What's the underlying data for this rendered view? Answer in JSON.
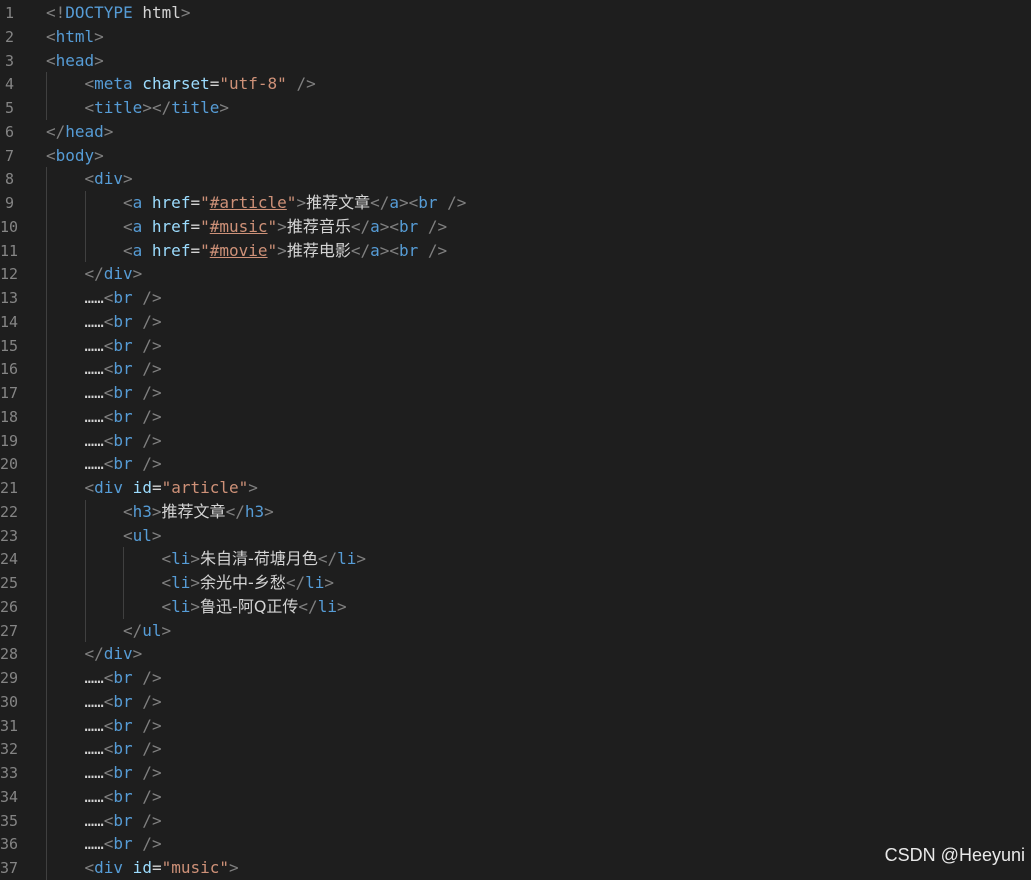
{
  "editor": {
    "lines": [
      {
        "n": "1",
        "indent": 0,
        "tokens": [
          [
            "br",
            "<!"
          ],
          [
            "doc",
            "DOCTYPE"
          ],
          [
            "txt",
            " html"
          ],
          [
            "br",
            ">"
          ]
        ]
      },
      {
        "n": "2",
        "indent": 0,
        "tokens": [
          [
            "br",
            "<"
          ],
          [
            "tag",
            "html"
          ],
          [
            "br",
            ">"
          ]
        ]
      },
      {
        "n": "3",
        "indent": 0,
        "tokens": [
          [
            "br",
            "<"
          ],
          [
            "tag",
            "head"
          ],
          [
            "br",
            ">"
          ]
        ]
      },
      {
        "n": "4",
        "indent": 1,
        "tokens": [
          [
            "br",
            "<"
          ],
          [
            "tag",
            "meta"
          ],
          [
            "attr",
            " charset"
          ],
          [
            "txt",
            "="
          ],
          [
            "str",
            "\"utf-8\""
          ],
          [
            "br",
            " />"
          ]
        ]
      },
      {
        "n": "5",
        "indent": 1,
        "tokens": [
          [
            "br",
            "<"
          ],
          [
            "tag",
            "title"
          ],
          [
            "br",
            "></"
          ],
          [
            "tag",
            "title"
          ],
          [
            "br",
            ">"
          ]
        ]
      },
      {
        "n": "6",
        "indent": 0,
        "tokens": [
          [
            "br",
            "</"
          ],
          [
            "tag",
            "head"
          ],
          [
            "br",
            ">"
          ]
        ]
      },
      {
        "n": "7",
        "indent": 0,
        "tokens": [
          [
            "br",
            "<"
          ],
          [
            "tag",
            "body"
          ],
          [
            "br",
            ">"
          ]
        ]
      },
      {
        "n": "8",
        "indent": 1,
        "tokens": [
          [
            "br",
            "<"
          ],
          [
            "tag",
            "div"
          ],
          [
            "br",
            ">"
          ]
        ]
      },
      {
        "n": "9",
        "indent": 2,
        "tokens": [
          [
            "br",
            "<"
          ],
          [
            "tag",
            "a"
          ],
          [
            "attr",
            " href"
          ],
          [
            "txt",
            "="
          ],
          [
            "str",
            "\""
          ],
          [
            "hl",
            "#article"
          ],
          [
            "str",
            "\""
          ],
          [
            "br",
            ">"
          ],
          [
            "cjk",
            "推荐文章"
          ],
          [
            "br",
            "</"
          ],
          [
            "tag",
            "a"
          ],
          [
            "br",
            "><"
          ],
          [
            "tag",
            "br"
          ],
          [
            "br",
            " />"
          ]
        ]
      },
      {
        "n": "10",
        "indent": 2,
        "tokens": [
          [
            "br",
            "<"
          ],
          [
            "tag",
            "a"
          ],
          [
            "attr",
            " href"
          ],
          [
            "txt",
            "="
          ],
          [
            "str",
            "\""
          ],
          [
            "hl",
            "#music"
          ],
          [
            "str",
            "\""
          ],
          [
            "br",
            ">"
          ],
          [
            "cjk",
            "推荐音乐"
          ],
          [
            "br",
            "</"
          ],
          [
            "tag",
            "a"
          ],
          [
            "br",
            "><"
          ],
          [
            "tag",
            "br"
          ],
          [
            "br",
            " />"
          ]
        ]
      },
      {
        "n": "11",
        "indent": 2,
        "tokens": [
          [
            "br",
            "<"
          ],
          [
            "tag",
            "a"
          ],
          [
            "attr",
            " href"
          ],
          [
            "txt",
            "="
          ],
          [
            "str",
            "\""
          ],
          [
            "hl",
            "#movie"
          ],
          [
            "str",
            "\""
          ],
          [
            "br",
            ">"
          ],
          [
            "cjk",
            "推荐电影"
          ],
          [
            "br",
            "</"
          ],
          [
            "tag",
            "a"
          ],
          [
            "br",
            "><"
          ],
          [
            "tag",
            "br"
          ],
          [
            "br",
            " />"
          ]
        ]
      },
      {
        "n": "12",
        "indent": 1,
        "tokens": [
          [
            "br",
            "</"
          ],
          [
            "tag",
            "div"
          ],
          [
            "br",
            ">"
          ]
        ]
      },
      {
        "n": "13",
        "indent": 1,
        "tokens": [
          [
            "txt",
            "……"
          ],
          [
            "br",
            "<"
          ],
          [
            "tag",
            "br"
          ],
          [
            "br",
            " />"
          ]
        ]
      },
      {
        "n": "14",
        "indent": 1,
        "tokens": [
          [
            "txt",
            "……"
          ],
          [
            "br",
            "<"
          ],
          [
            "tag",
            "br"
          ],
          [
            "br",
            " />"
          ]
        ]
      },
      {
        "n": "15",
        "indent": 1,
        "tokens": [
          [
            "txt",
            "……"
          ],
          [
            "br",
            "<"
          ],
          [
            "tag",
            "br"
          ],
          [
            "br",
            " />"
          ]
        ]
      },
      {
        "n": "16",
        "indent": 1,
        "tokens": [
          [
            "txt",
            "……"
          ],
          [
            "br",
            "<"
          ],
          [
            "tag",
            "br"
          ],
          [
            "br",
            " />"
          ]
        ]
      },
      {
        "n": "17",
        "indent": 1,
        "tokens": [
          [
            "txt",
            "……"
          ],
          [
            "br",
            "<"
          ],
          [
            "tag",
            "br"
          ],
          [
            "br",
            " />"
          ]
        ]
      },
      {
        "n": "18",
        "indent": 1,
        "tokens": [
          [
            "txt",
            "……"
          ],
          [
            "br",
            "<"
          ],
          [
            "tag",
            "br"
          ],
          [
            "br",
            " />"
          ]
        ]
      },
      {
        "n": "19",
        "indent": 1,
        "tokens": [
          [
            "txt",
            "……"
          ],
          [
            "br",
            "<"
          ],
          [
            "tag",
            "br"
          ],
          [
            "br",
            " />"
          ]
        ]
      },
      {
        "n": "20",
        "indent": 1,
        "tokens": [
          [
            "txt",
            "……"
          ],
          [
            "br",
            "<"
          ],
          [
            "tag",
            "br"
          ],
          [
            "br",
            " />"
          ]
        ]
      },
      {
        "n": "21",
        "indent": 1,
        "tokens": [
          [
            "br",
            "<"
          ],
          [
            "tag",
            "div"
          ],
          [
            "attr",
            " id"
          ],
          [
            "txt",
            "="
          ],
          [
            "str",
            "\"article\""
          ],
          [
            "br",
            ">"
          ]
        ]
      },
      {
        "n": "22",
        "indent": 2,
        "tokens": [
          [
            "br",
            "<"
          ],
          [
            "tag",
            "h3"
          ],
          [
            "br",
            ">"
          ],
          [
            "cjk",
            "推荐文章"
          ],
          [
            "br",
            "</"
          ],
          [
            "tag",
            "h3"
          ],
          [
            "br",
            ">"
          ]
        ]
      },
      {
        "n": "23",
        "indent": 2,
        "tokens": [
          [
            "br",
            "<"
          ],
          [
            "tag",
            "ul"
          ],
          [
            "br",
            ">"
          ]
        ]
      },
      {
        "n": "24",
        "indent": 3,
        "tokens": [
          [
            "br",
            "<"
          ],
          [
            "tag",
            "li"
          ],
          [
            "br",
            ">"
          ],
          [
            "cjk",
            "朱自清-荷塘月色"
          ],
          [
            "br",
            "</"
          ],
          [
            "tag",
            "li"
          ],
          [
            "br",
            ">"
          ]
        ]
      },
      {
        "n": "25",
        "indent": 3,
        "tokens": [
          [
            "br",
            "<"
          ],
          [
            "tag",
            "li"
          ],
          [
            "br",
            ">"
          ],
          [
            "cjk",
            "余光中-乡愁"
          ],
          [
            "br",
            "</"
          ],
          [
            "tag",
            "li"
          ],
          [
            "br",
            ">"
          ]
        ]
      },
      {
        "n": "26",
        "indent": 3,
        "tokens": [
          [
            "br",
            "<"
          ],
          [
            "tag",
            "li"
          ],
          [
            "br",
            ">"
          ],
          [
            "cjk",
            "鲁迅-阿Q正传"
          ],
          [
            "br",
            "</"
          ],
          [
            "tag",
            "li"
          ],
          [
            "br",
            ">"
          ]
        ]
      },
      {
        "n": "27",
        "indent": 2,
        "tokens": [
          [
            "br",
            "</"
          ],
          [
            "tag",
            "ul"
          ],
          [
            "br",
            ">"
          ]
        ]
      },
      {
        "n": "28",
        "indent": 1,
        "tokens": [
          [
            "br",
            "</"
          ],
          [
            "tag",
            "div"
          ],
          [
            "br",
            ">"
          ]
        ]
      },
      {
        "n": "29",
        "indent": 1,
        "tokens": [
          [
            "txt",
            "……"
          ],
          [
            "br",
            "<"
          ],
          [
            "tag",
            "br"
          ],
          [
            "br",
            " />"
          ]
        ]
      },
      {
        "n": "30",
        "indent": 1,
        "tokens": [
          [
            "txt",
            "……"
          ],
          [
            "br",
            "<"
          ],
          [
            "tag",
            "br"
          ],
          [
            "br",
            " />"
          ]
        ]
      },
      {
        "n": "31",
        "indent": 1,
        "tokens": [
          [
            "txt",
            "……"
          ],
          [
            "br",
            "<"
          ],
          [
            "tag",
            "br"
          ],
          [
            "br",
            " />"
          ]
        ]
      },
      {
        "n": "32",
        "indent": 1,
        "tokens": [
          [
            "txt",
            "……"
          ],
          [
            "br",
            "<"
          ],
          [
            "tag",
            "br"
          ],
          [
            "br",
            " />"
          ]
        ]
      },
      {
        "n": "33",
        "indent": 1,
        "tokens": [
          [
            "txt",
            "……"
          ],
          [
            "br",
            "<"
          ],
          [
            "tag",
            "br"
          ],
          [
            "br",
            " />"
          ]
        ]
      },
      {
        "n": "34",
        "indent": 1,
        "tokens": [
          [
            "txt",
            "……"
          ],
          [
            "br",
            "<"
          ],
          [
            "tag",
            "br"
          ],
          [
            "br",
            " />"
          ]
        ]
      },
      {
        "n": "35",
        "indent": 1,
        "tokens": [
          [
            "txt",
            "……"
          ],
          [
            "br",
            "<"
          ],
          [
            "tag",
            "br"
          ],
          [
            "br",
            " />"
          ]
        ]
      },
      {
        "n": "36",
        "indent": 1,
        "tokens": [
          [
            "txt",
            "……"
          ],
          [
            "br",
            "<"
          ],
          [
            "tag",
            "br"
          ],
          [
            "br",
            " />"
          ]
        ]
      },
      {
        "n": "37",
        "indent": 1,
        "tokens": [
          [
            "br",
            "<"
          ],
          [
            "tag",
            "div"
          ],
          [
            "attr",
            " id"
          ],
          [
            "txt",
            "="
          ],
          [
            "str",
            "\"music\""
          ],
          [
            "br",
            ">"
          ]
        ]
      }
    ]
  },
  "watermark": "CSDN @Heeyuni",
  "colors": {
    "background": "#1e1e1e",
    "tag": "#569cd6",
    "bracket": "#808080",
    "attribute": "#9cdcfe",
    "string": "#ce9178",
    "text": "#d4d4d4",
    "line_number": "#858585"
  }
}
